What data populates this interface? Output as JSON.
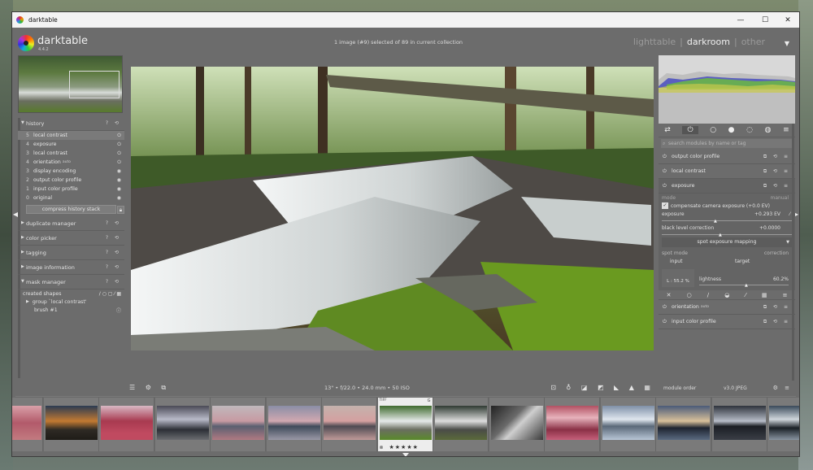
{
  "window": {
    "title": "darktable",
    "minimize": "—",
    "maximize": "☐",
    "close": "✕"
  },
  "header": {
    "brand": "darktable",
    "version": "4.4.2",
    "collection_info": "1 image (#9) selected of 89 in current collection",
    "views": [
      "lighttable",
      "|",
      "darkroom",
      "|",
      "other"
    ],
    "active_view": "darkroom"
  },
  "left_panel": {
    "history": {
      "title": "history",
      "items": [
        {
          "n": "5",
          "label": "local contrast",
          "extra": "",
          "state": "on",
          "selected": true
        },
        {
          "n": "4",
          "label": "exposure",
          "extra": "",
          "state": "on",
          "selected": false
        },
        {
          "n": "3",
          "label": "local contrast",
          "extra": "",
          "state": "on",
          "selected": false
        },
        {
          "n": "4",
          "label": "orientation",
          "extra": "auto",
          "state": "on",
          "selected": false
        },
        {
          "n": "3",
          "label": "display encoding",
          "extra": "",
          "state": "fixed",
          "selected": false
        },
        {
          "n": "2",
          "label": "output color profile",
          "extra": "",
          "state": "fixed",
          "selected": false
        },
        {
          "n": "1",
          "label": "input color profile",
          "extra": "",
          "state": "fixed",
          "selected": false
        },
        {
          "n": "0",
          "label": "original",
          "extra": "",
          "state": "fixed",
          "selected": false
        }
      ],
      "compress_button": "compress history stack"
    },
    "sections": [
      "duplicate manager",
      "color picker",
      "tagging",
      "image information"
    ],
    "mask_manager": {
      "title": "mask manager",
      "created_shapes": "created shapes",
      "group": "group `local contrast'",
      "brush": "brush #1"
    }
  },
  "bottom_bar": {
    "exif": "13\" • f/22.0 • 24.0 mm • 50 ISO"
  },
  "right_panel": {
    "search_placeholder": "search modules by name or tag",
    "modules_top": [
      "output color profile",
      "local contrast"
    ],
    "exposure": {
      "title": "exposure",
      "mode_label": "mode",
      "mode_value": "manual",
      "compensate_label": "compensate camera exposure (+0.0 EV)",
      "exposure_label": "exposure",
      "exposure_value": "+0.293 EV",
      "black_label": "black level correction",
      "black_value": "+0.0000",
      "spot_title": "spot exposure mapping",
      "spot_mode_label": "spot mode",
      "spot_mode_value": "correction",
      "input_label": "input",
      "target_label": "target",
      "lightness_label": "lightness",
      "lightness_value": "60.2%",
      "input_value": "L : 55.2 %"
    },
    "modules_bottom": [
      {
        "label": "orientation",
        "extra": "auto"
      },
      {
        "label": "input color profile",
        "extra": ""
      }
    ],
    "footer": {
      "module_order_label": "module order",
      "module_order_value": "v3.0 JPEG"
    }
  },
  "filmstrip": {
    "selected_label": "TIFF",
    "selected_stars": "★★★★★",
    "selected_reject": "⊗",
    "selected_group": "G"
  },
  "colors": {
    "panel": "#6c6c6c",
    "highlight": "#7a7a7a",
    "accent_histogram_green": "#6bbf3a"
  }
}
